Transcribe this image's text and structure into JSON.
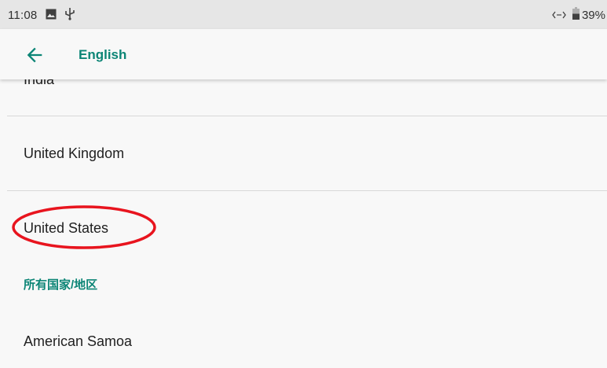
{
  "status_bar": {
    "time": "11:08",
    "battery_percent": "39%",
    "icons": [
      "image-icon",
      "usb-icon",
      "data-transfer-icon",
      "battery-icon"
    ]
  },
  "toolbar": {
    "title": "English",
    "back_icon": "arrow-back-icon"
  },
  "list": {
    "items": [
      {
        "label": "India"
      },
      {
        "label": "United Kingdom"
      },
      {
        "label": "United States",
        "highlighted": true
      },
      {
        "label": "American Samoa"
      }
    ],
    "section_header": "所有国家/地区"
  },
  "colors": {
    "accent": "#0c8576",
    "highlight_ring": "#e8141e",
    "status_bar_bg": "#e6e6e6",
    "background": "#f8f8f8"
  }
}
